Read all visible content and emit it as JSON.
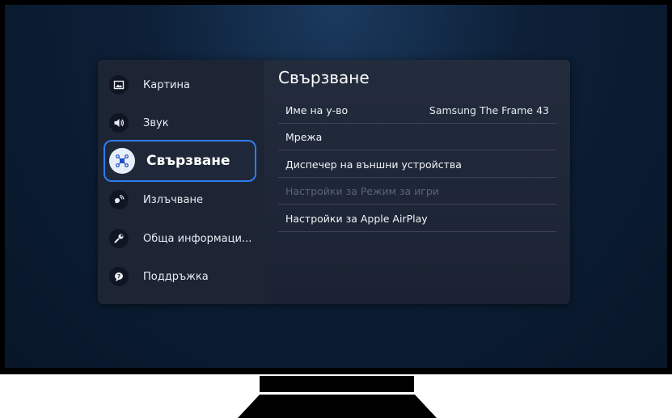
{
  "sidebar": {
    "items": [
      {
        "label": "Картина",
        "icon": "picture-icon"
      },
      {
        "label": "Звук",
        "icon": "sound-icon"
      },
      {
        "label": "Свързване",
        "icon": "connection-icon",
        "selected": true
      },
      {
        "label": "Излъчване",
        "icon": "broadcast-icon"
      },
      {
        "label": "Обща информаци...",
        "icon": "wrench-icon"
      },
      {
        "label": "Поддръжка",
        "icon": "support-icon"
      }
    ]
  },
  "content": {
    "title": "Свързване",
    "rows": [
      {
        "label": "Име на у-во",
        "value": "Samsung The Frame 43",
        "disabled": false
      },
      {
        "label": "Мрежа",
        "value": "",
        "disabled": false
      },
      {
        "label": "Диспечер на външни устройства",
        "value": "",
        "disabled": false
      },
      {
        "label": "Настройки за Режим за игри",
        "value": "",
        "disabled": true
      },
      {
        "label": "Настройки за Apple AirPlay",
        "value": "",
        "disabled": false
      }
    ]
  },
  "colors": {
    "accent": "#2f7bf0",
    "panel_bg": "#1a2232",
    "disabled_text": "#5a6476"
  }
}
